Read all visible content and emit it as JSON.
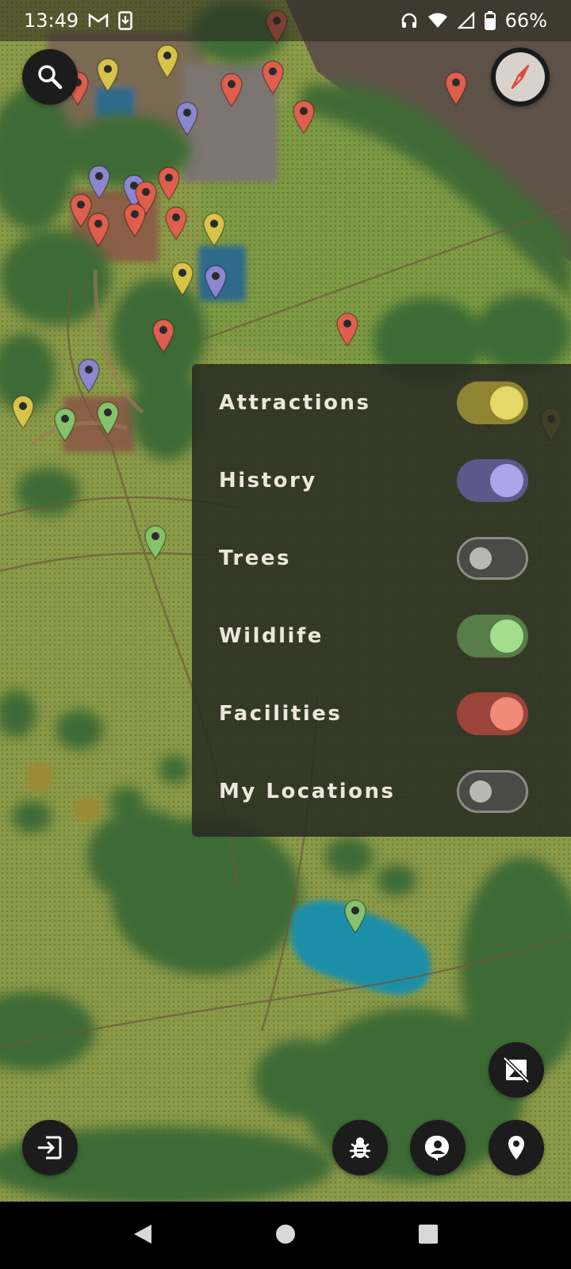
{
  "status_bar": {
    "time": "13:49",
    "battery_text": "66%",
    "icons": [
      "gmail-icon",
      "download-notification-icon",
      "headphones-icon",
      "wifi-icon",
      "signal-icon",
      "battery-icon"
    ]
  },
  "map": {
    "description_icons": [
      "search-icon",
      "compass-icon"
    ],
    "colors": {
      "attractions": "#d6c34a",
      "history": "#8c86cf",
      "trees": "#8a8a84",
      "wildlife": "#86c26b",
      "facilities": "#de5f4e",
      "pond": "#1d8ea8"
    }
  },
  "layers": {
    "items": [
      {
        "label": "Attractions",
        "enabled": true,
        "color": "#d6c34a",
        "knob": "#e5d866",
        "track": "#8f8432"
      },
      {
        "label": "History",
        "enabled": true,
        "color": "#8c86cf",
        "knob": "#aba6ea",
        "track": "#5c5889"
      },
      {
        "label": "Trees",
        "enabled": false,
        "color": "#8a8a84",
        "knob": "#b9b9b4",
        "track": "#4a4a46"
      },
      {
        "label": "Wildlife",
        "enabled": true,
        "color": "#86c26b",
        "knob": "#a3de8c",
        "track": "#577d48"
      },
      {
        "label": "Facilities",
        "enabled": true,
        "color": "#de5f4e",
        "knob": "#f08a79",
        "track": "#9a443a"
      },
      {
        "label": "My Locations",
        "enabled": false,
        "color": "#8a8a84",
        "knob": "#b9b9b4",
        "track": "#4a4a46"
      }
    ]
  },
  "buttons": {
    "icons": [
      "exit-icon",
      "bug-icon",
      "account-pin-icon",
      "location-pin-icon",
      "image-off-icon"
    ]
  },
  "nav_bar": {
    "icons": [
      "back-icon",
      "home-icon",
      "recents-icon"
    ]
  }
}
